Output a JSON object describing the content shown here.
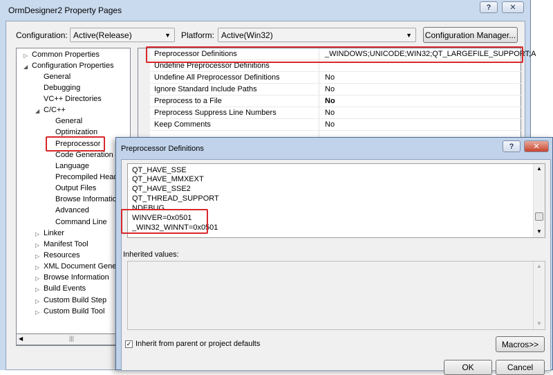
{
  "main_window": {
    "title": "OrmDesigner2 Property Pages",
    "help_button": "?",
    "close_button": "✕"
  },
  "config_bar": {
    "configuration_label": "Configuration:",
    "configuration_value": "Active(Release)",
    "platform_label": "Platform:",
    "platform_value": "Active(Win32)",
    "manager_button": "Configuration Manager..."
  },
  "tree": {
    "items": [
      {
        "label": "Common Properties"
      },
      {
        "label": "Configuration Properties"
      },
      {
        "label": "General"
      },
      {
        "label": "Debugging"
      },
      {
        "label": "VC++ Directories"
      },
      {
        "label": "C/C++"
      },
      {
        "label": "General"
      },
      {
        "label": "Optimization"
      },
      {
        "label": "Preprocessor"
      },
      {
        "label": "Code Generation"
      },
      {
        "label": "Language"
      },
      {
        "label": "Precompiled Head"
      },
      {
        "label": "Output Files"
      },
      {
        "label": "Browse Informatio"
      },
      {
        "label": "Advanced"
      },
      {
        "label": "Command Line"
      },
      {
        "label": "Linker"
      },
      {
        "label": "Manifest Tool"
      },
      {
        "label": "Resources"
      },
      {
        "label": "XML Document Gener"
      },
      {
        "label": "Browse Information"
      },
      {
        "label": "Build Events"
      },
      {
        "label": "Custom Build Step"
      },
      {
        "label": "Custom Build Tool"
      }
    ],
    "scroll_grip": "|||"
  },
  "grid": {
    "rows": [
      {
        "name": "Preprocessor Definitions",
        "value": "_WINDOWS;UNICODE;WIN32;QT_LARGEFILE_SUPPORT;A"
      },
      {
        "name": "Undefine Preprocessor Definitions",
        "value": ""
      },
      {
        "name": "Undefine All Preprocessor Definitions",
        "value": "No"
      },
      {
        "name": "Ignore Standard Include Paths",
        "value": "No"
      },
      {
        "name": "Preprocess to a File",
        "value": "No"
      },
      {
        "name": "Preprocess Suppress Line Numbers",
        "value": "No"
      },
      {
        "name": "Keep Comments",
        "value": "No"
      }
    ]
  },
  "dialog": {
    "title": "Preprocessor Definitions",
    "help_button": "?",
    "close_button": "✕",
    "definitions": [
      "QT_HAVE_SSE",
      "QT_HAVE_MMXEXT",
      "QT_HAVE_SSE2",
      "QT_THREAD_SUPPORT",
      "NDEBUG",
      "WINVER=0x0501",
      "_WIN32_WINNT=0x0501"
    ],
    "inherited_label": "Inherited values:",
    "inherit_checkbox_label": "Inherit from parent or project defaults",
    "inherit_checked": true,
    "macros_button": "Macros>>",
    "ok_button": "OK",
    "cancel_button": "Cancel"
  },
  "colors": {
    "highlight_box": "#d9262a",
    "window_frame": "#c9daee"
  }
}
